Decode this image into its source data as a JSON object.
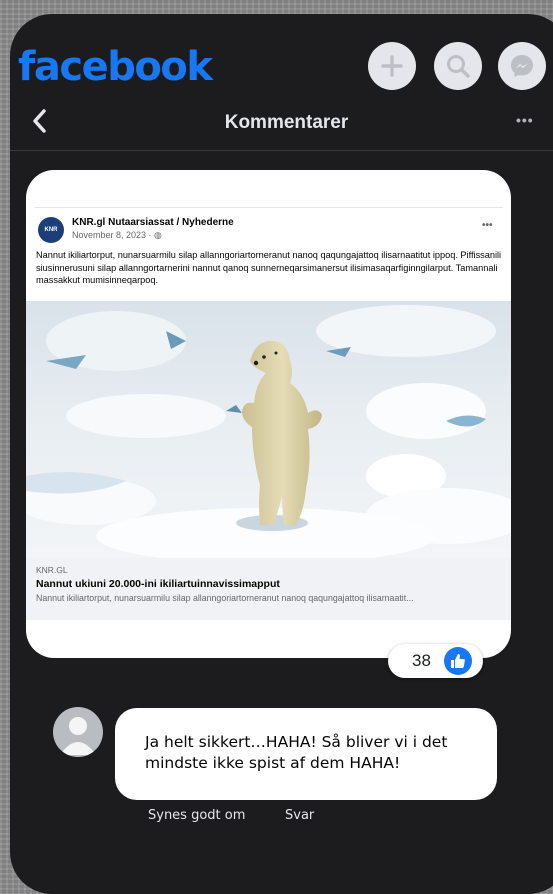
{
  "header": {
    "logo_text": "facebook",
    "title": "Kommentarer",
    "more": "•••",
    "icons": [
      "plus-icon",
      "search-icon",
      "messenger-icon",
      "back-chevron-icon"
    ]
  },
  "shared_post": {
    "source_name": "KNR.gl Nutaarsiassat / Nyhederne",
    "source_logo": "KNR",
    "date": "November 8, 2023 · ",
    "more": "•••",
    "text": "Nannut ikiliartorput, nunarsuarmilu silap allanngoriartorneranut nanoq qaqungajattoq ilisarnaatitut ippoq. Piffissanili siusinnerusuni silap allanngortarnerini nannut qanoq sunnerneqarsimanersut ilisimasaqarfiginngilarput. Tamannali massakkut mumisinneqarpoq.",
    "image_alt_icon": "polar-bear-photo",
    "link": {
      "domain": "KNR.GL",
      "title": "Nannut ukiuni 20.000-ini ikiliartuinnavissimapput",
      "subtitle": "Nannut ikiliartorput, nunarsuarmilu silap allanngoriartorneranut nanoq qaqungajattoq ilisarnaatit..."
    }
  },
  "reactions": {
    "count": "38",
    "icon": "like-icon"
  },
  "comment": {
    "text": "Ja helt sikkert…HAHA! Så bliver vi i det mindste ikke spist af dem HAHA!",
    "like_action": "Synes godt om",
    "reply_action": "Svar"
  },
  "colors": {
    "brand": "#1877f2",
    "background": "#1c1c1e",
    "bubble": "#ffffff"
  }
}
